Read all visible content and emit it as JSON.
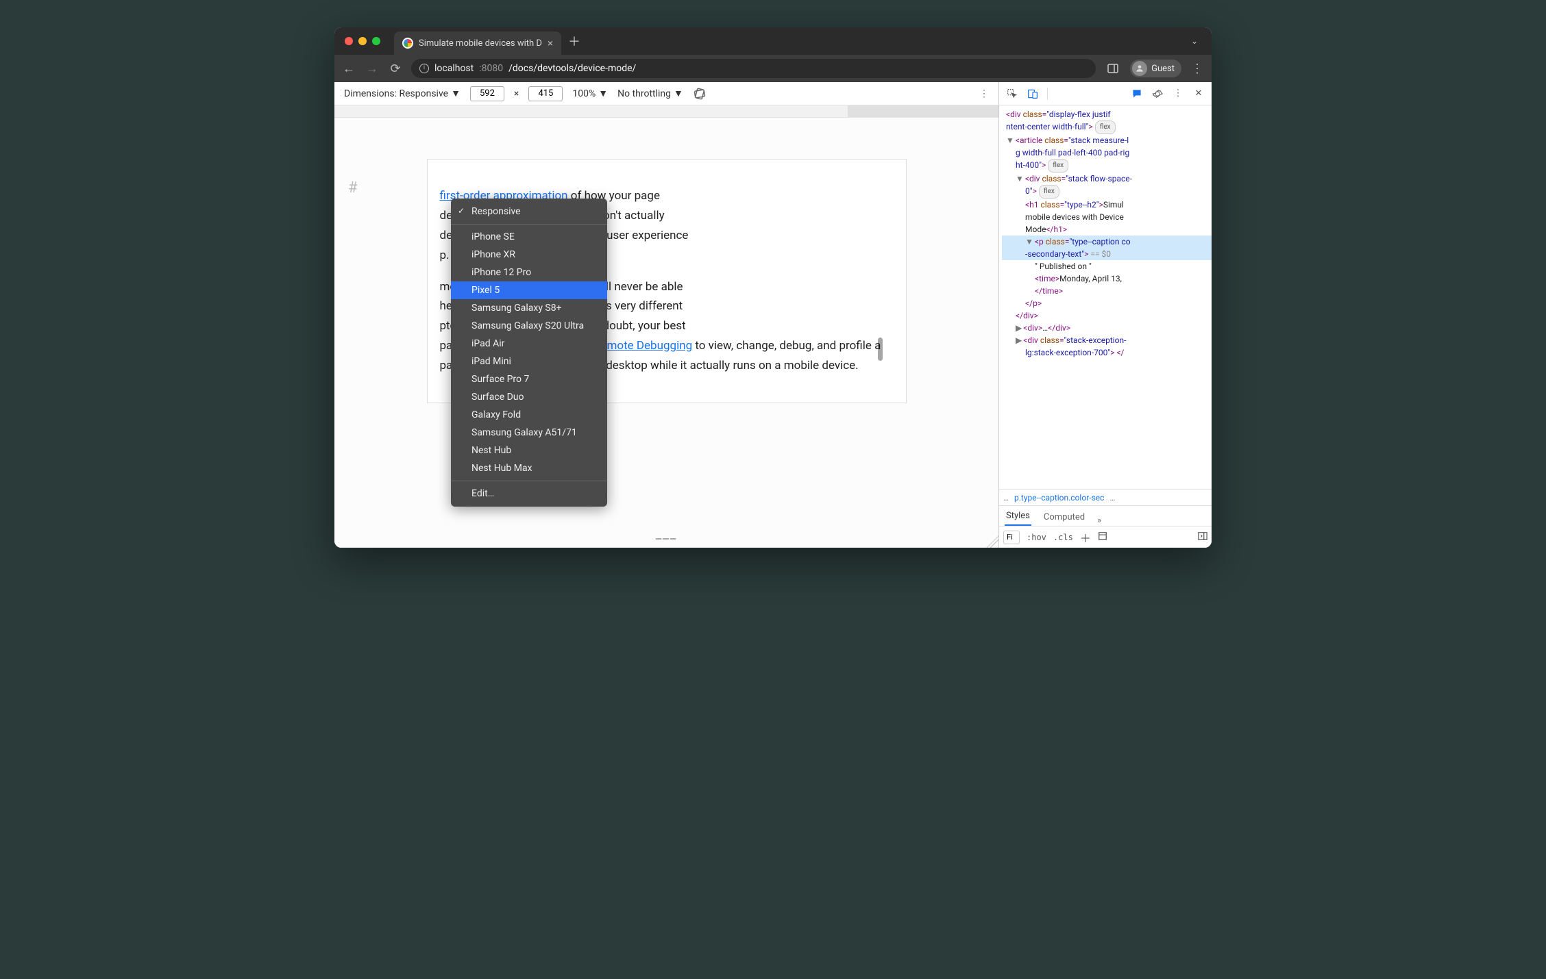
{
  "window": {
    "traffic": {
      "close": "#ff5f56",
      "min": "#ffbd2e",
      "max": "#27c93f"
    },
    "tab_title": "Simulate mobile devices with D",
    "address": {
      "host": "localhost",
      "port": ":8080",
      "path": "/docs/devtools/device-mode/"
    },
    "guest_label": "Guest"
  },
  "device_toolbar": {
    "dimensions_label": "Dimensions: Responsive",
    "width": "592",
    "height": "415",
    "separator": "×",
    "zoom": "100%",
    "throttling": "No throttling"
  },
  "dropdown": {
    "selected": "Responsive",
    "highlighted": "Pixel 5",
    "items": [
      "iPhone SE",
      "iPhone XR",
      "iPhone 12 Pro",
      "Pixel 5",
      "Samsung Galaxy S8+",
      "Samsung Galaxy S20 Ultra",
      "iPad Air",
      "iPad Mini",
      "Surface Pro 7",
      "Surface Duo",
      "Galaxy Fold",
      "Samsung Galaxy A51/71",
      "Nest Hub",
      "Nest Hub Max"
    ],
    "edit": "Edit…"
  },
  "page": {
    "link1": "first-order approximation",
    "text1a": " of how your page ",
    "text1b": "device. With Device Mode you don't actually ",
    "text1c": "device. You simulate the mobile user experience ",
    "text1d": "p.",
    "text2a": "mobile devices that DevTools will never be able ",
    "text2b": "he architecture of mobile CPUs is very different ",
    "text2c": "ptop or desktop CPUs. When in doubt, your best ",
    "text2d": "page on a mobile device. Use ",
    "link2": "Remote Debugging",
    "text2e": " to view, change, debug, and profile a page's code from your laptop or desktop while it actually runs on a mobile device."
  },
  "dom": {
    "l1a": "div",
    "l1_attr": "class",
    "l1_val": "display-flex justif",
    "l1b": "ntent-center width-full\"",
    "flex_badge": "flex",
    "l2a": "article",
    "l2_val": "stack measure-lg width-full pad-left-400 pad-right-400",
    "l3a": "div",
    "l3_val": "stack flow-space-0",
    "l4a": "h1",
    "l4_val": "type--h2",
    "l4_txt": "Simulate mobile devices with Device Mode",
    "l4_close": "h1",
    "l5a": "p",
    "l5_val": "type--caption color-secondary-text",
    "l5_ref": "== $0",
    "l6_txt": "\" Published on \"",
    "l7a": "time",
    "l7_txt": "Monday, April 13, ",
    "l7_close": "time",
    "l8_close": "p",
    "l9_close": "div",
    "l10a": "div",
    "l10_txt": "…",
    "l10_close": "div",
    "l11a": "div",
    "l11_val": "stack-exception-lg:stack-exception-700"
  },
  "breadcrumb": {
    "dots": "…",
    "sel": "p.type--caption.color-sec",
    "dots2": "…"
  },
  "styles": {
    "tab_styles": "Styles",
    "tab_computed": "Computed",
    "chev": "»",
    "filter_text": "Fi",
    "hov": ":hov",
    "cls": ".cls"
  }
}
